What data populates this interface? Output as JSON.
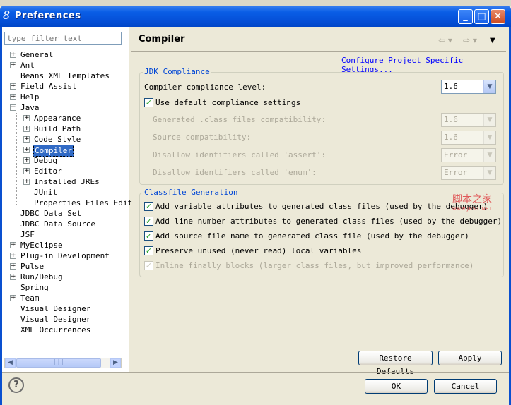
{
  "window": {
    "title": "Preferences",
    "icon": "8",
    "minimize_glyph": "_",
    "maximize_glyph": "□",
    "close_glyph": "✕"
  },
  "sidebar": {
    "filter_placeholder": "type filter text",
    "tree": [
      {
        "label": "General",
        "toggle": "+",
        "level": 0
      },
      {
        "label": "Ant",
        "toggle": "+",
        "level": 0
      },
      {
        "label": "Beans XML Templates",
        "toggle": "",
        "level": 0
      },
      {
        "label": "Field Assist",
        "toggle": "+",
        "level": 0
      },
      {
        "label": "Help",
        "toggle": "+",
        "level": 0
      },
      {
        "label": "Java",
        "toggle": "−",
        "level": 0
      },
      {
        "label": "Appearance",
        "toggle": "+",
        "level": 1
      },
      {
        "label": "Build Path",
        "toggle": "+",
        "level": 1
      },
      {
        "label": "Code Style",
        "toggle": "+",
        "level": 1
      },
      {
        "label": "Compiler",
        "toggle": "+",
        "level": 1,
        "selected": true
      },
      {
        "label": "Debug",
        "toggle": "+",
        "level": 1
      },
      {
        "label": "Editor",
        "toggle": "+",
        "level": 1
      },
      {
        "label": "Installed JREs",
        "toggle": "+",
        "level": 1
      },
      {
        "label": "JUnit",
        "toggle": "",
        "level": 1
      },
      {
        "label": "Properties Files Edit",
        "toggle": "",
        "level": 1
      },
      {
        "label": "JDBC Data Set",
        "toggle": "",
        "level": 0
      },
      {
        "label": "JDBC Data Source",
        "toggle": "",
        "level": 0
      },
      {
        "label": "JSF",
        "toggle": "",
        "level": 0
      },
      {
        "label": "MyEclipse",
        "toggle": "+",
        "level": 0
      },
      {
        "label": "Plug-in Development",
        "toggle": "+",
        "level": 0
      },
      {
        "label": "Pulse",
        "toggle": "+",
        "level": 0
      },
      {
        "label": "Run/Debug",
        "toggle": "+",
        "level": 0
      },
      {
        "label": "Spring",
        "toggle": "",
        "level": 0
      },
      {
        "label": "Team",
        "toggle": "+",
        "level": 0
      },
      {
        "label": "Visual Designer",
        "toggle": "",
        "level": 0
      },
      {
        "label": "Visual Designer",
        "toggle": "",
        "level": 0
      },
      {
        "label": "XML Occurrences",
        "toggle": "",
        "level": 0
      }
    ],
    "scroll_left": "◀",
    "scroll_right": "▶",
    "scroll_grip": "|||"
  },
  "page": {
    "title": "Compiler",
    "nav_back": "⇦ ▾",
    "nav_forward": "⇨ ▾",
    "menu": "▼",
    "config_link": "Configure Project Specific Settings...",
    "jdk_group_title": "JDK Compliance",
    "compliance_level_label": "Compiler compliance level:",
    "compliance_level_value": "1.6",
    "use_default_label": "Use default compliance settings",
    "use_default_checked": true,
    "disabled_settings": [
      {
        "label": "Generated .class files compatibility:",
        "value": "1.6"
      },
      {
        "label": "Source compatibility:",
        "value": "1.6"
      },
      {
        "label": "Disallow identifiers called 'assert':",
        "value": "Error"
      },
      {
        "label": "Disallow identifiers called 'enum':",
        "value": "Error"
      }
    ],
    "classfile_group_title": "Classfile Generation",
    "classfile_options": [
      {
        "label": "Add variable attributes to generated class files (used by the debugger)",
        "checked": true,
        "enabled": true
      },
      {
        "label": "Add line number attributes to generated class files (used by the debugger)",
        "checked": true,
        "enabled": true
      },
      {
        "label": "Add source file name to generated class file (used by the debugger)",
        "checked": true,
        "enabled": true
      },
      {
        "label": "Preserve unused (never read) local variables",
        "checked": true,
        "enabled": true
      },
      {
        "label": "Inline finally blocks (larger class files, but improved performance)",
        "checked": true,
        "enabled": false
      }
    ],
    "restore_defaults_label": "Restore Defaults",
    "apply_label": "Apply"
  },
  "footer": {
    "help_glyph": "?",
    "ok_label": "OK",
    "cancel_label": "Cancel"
  },
  "watermark": {
    "text": "脚本之家",
    "sub": "www.JB51.NET"
  },
  "colors": {
    "title_bar": "#0550d8",
    "selection": "#316ac5",
    "link": "#0000ff",
    "group_title": "#0046d5"
  }
}
